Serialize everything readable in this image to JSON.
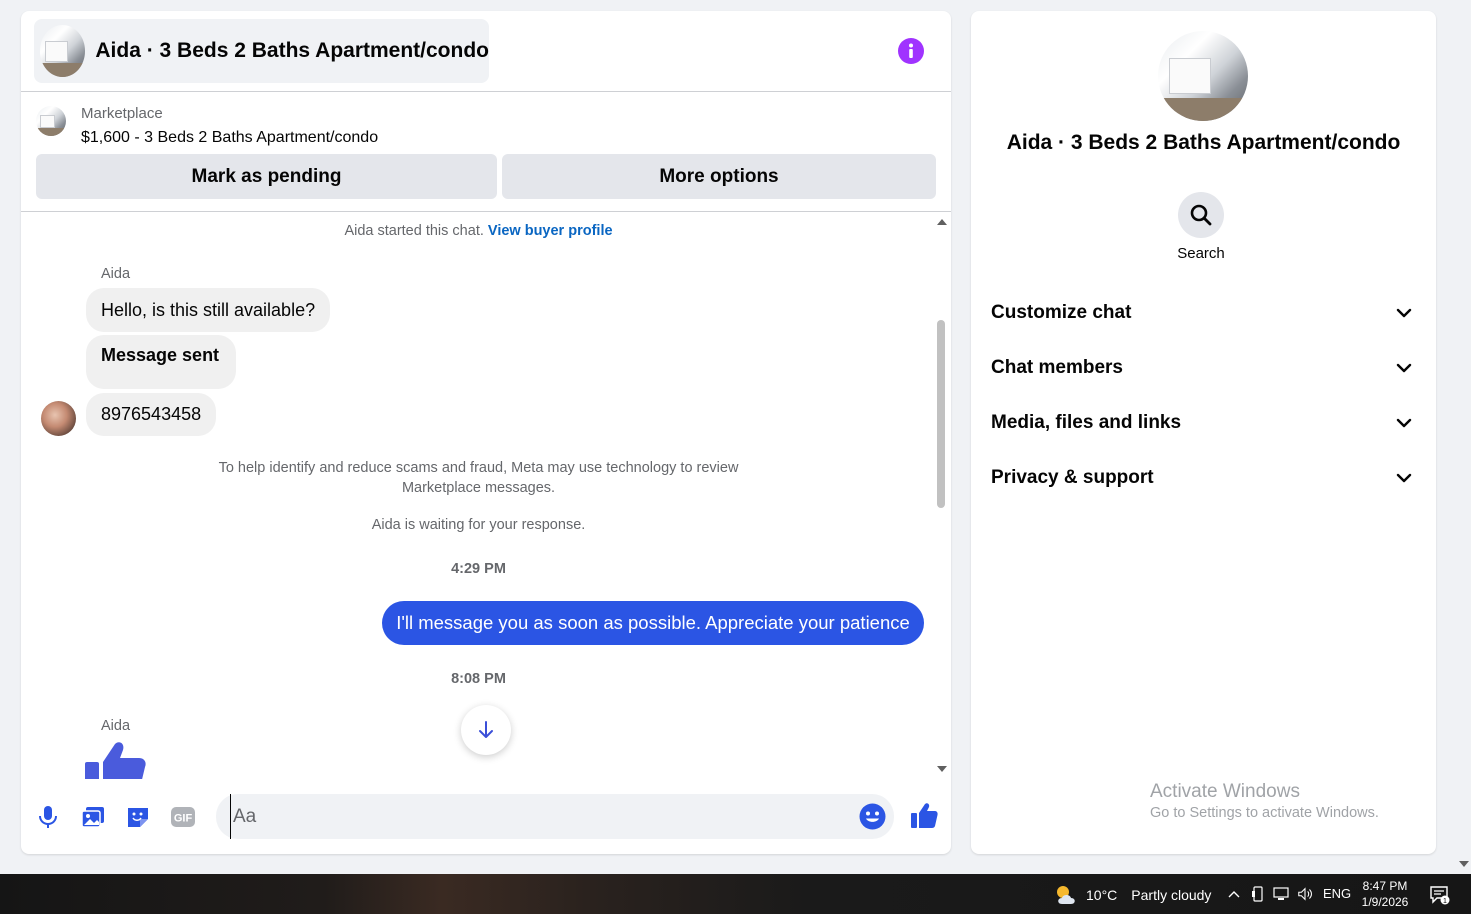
{
  "header": {
    "title": "Aida · 3 Beds 2 Baths Apartment/condo",
    "info_icon": "info-icon",
    "accent_color": "#a033ff"
  },
  "listing": {
    "source": "Marketplace",
    "price_title": "$1,600 - 3 Beds 2 Baths Apartment/condo",
    "pending_label": "Mark as pending",
    "more_label": "More options"
  },
  "messages": {
    "started_text": "Aida started this chat.",
    "view_profile": "View buyer profile",
    "sender1": "Aida",
    "msg1": "Hello, is this still available?",
    "msg2": "Message sent",
    "msg3": "8976543458",
    "scam_notice": "To help identify and reduce scams and fraud, Meta may use technology to review Marketplace messages.",
    "waiting": "Aida is waiting for your response.",
    "time1": "4:29 PM",
    "outgoing": "I'll message you as soon as possible. Appreciate your patience",
    "time2": "8:08 PM",
    "sender2": "Aida",
    "outgoing_color": "#2b55e4"
  },
  "composer": {
    "placeholder": "Aa",
    "icons": [
      "microphone-icon",
      "photo-icon",
      "sticker-icon",
      "gif-icon",
      "emoji-icon",
      "like-icon"
    ]
  },
  "info_panel": {
    "title": "Aida · 3 Beds 2 Baths Apartment/condo",
    "search_label": "Search",
    "sections": [
      "Customize chat",
      "Chat members",
      "Media, files and links",
      "Privacy & support"
    ]
  },
  "watermark": {
    "title": "Activate Windows",
    "subtitle": "Go to Settings to activate Windows."
  },
  "taskbar": {
    "temperature": "10°C",
    "weather": "Partly cloudy",
    "language": "ENG",
    "time": "8:47 PM",
    "date": "1/9/2026",
    "notification_count": "1"
  }
}
